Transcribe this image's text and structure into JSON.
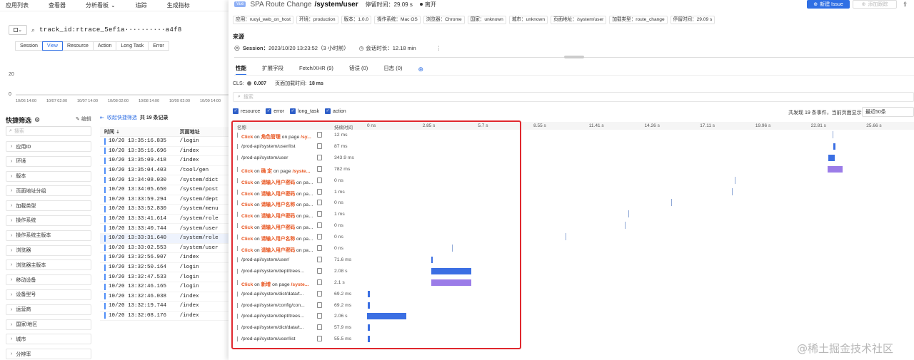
{
  "top_nav": [
    "应用列表",
    "查看器",
    "分析看板",
    "追踪",
    "生成指标"
  ],
  "top_nav_dropdown_index": 2,
  "search": {
    "scope": "",
    "query": "track_id:rtrace_5ef1a··········a4f8"
  },
  "type_bar": {
    "items": [
      "Session",
      "View",
      "Resource",
      "Action",
      "Long Task",
      "Error"
    ],
    "active": "View"
  },
  "histogram": {
    "y_ticks": [
      "20",
      "0"
    ],
    "x_ticks": [
      "10/06 14:00",
      "10/07 02:00",
      "10/07 14:00",
      "10/08 02:00",
      "10/08 14:00",
      "10/09 02:00",
      "10/09 14:00"
    ]
  },
  "quick_filter": {
    "title": "快捷筛选",
    "edit_label": "编辑",
    "search_placeholder": "搜索",
    "items": [
      "应用ID",
      "环境",
      "版本",
      "页面地址分组",
      "加载类型",
      "操作系统",
      "操作系统主版本",
      "浏览器",
      "浏览器主版本",
      "移动设备",
      "设备型号",
      "运营商",
      "国家/地区",
      "城市",
      "分辨率"
    ]
  },
  "records": {
    "collapse_label": "收起快捷筛选",
    "count_text": "共 19 条记录"
  },
  "table": {
    "headers": [
      "时间",
      "页面地址"
    ],
    "selected_index": 10,
    "rows": [
      {
        "time": "10/20 13:35:16.835",
        "page": "/login"
      },
      {
        "time": "10/20 13:35:16.696",
        "page": "/index"
      },
      {
        "time": "10/20 13:35:09.418",
        "page": "/index"
      },
      {
        "time": "10/20 13:35:04.403",
        "page": "/tool/gen"
      },
      {
        "time": "10/20 13:34:08.030",
        "page": "/system/dict"
      },
      {
        "time": "10/20 13:34:05.650",
        "page": "/system/post"
      },
      {
        "time": "10/20 13:33:59.294",
        "page": "/system/dept"
      },
      {
        "time": "10/20 13:33:52.830",
        "page": "/system/menu"
      },
      {
        "time": "10/20 13:33:41.614",
        "page": "/system/role"
      },
      {
        "time": "10/20 13:33:40.744",
        "page": "/system/user"
      },
      {
        "time": "10/20 13:33:31.640",
        "page": "/system/role"
      },
      {
        "time": "10/20 13:33:02.553",
        "page": "/system/user"
      },
      {
        "time": "10/20 13:32:56.907",
        "page": "/index"
      },
      {
        "time": "10/20 13:32:50.164",
        "page": "/login"
      },
      {
        "time": "10/20 13:32:47.533",
        "page": "/login"
      },
      {
        "time": "10/20 13:32:46.165",
        "page": "/login"
      },
      {
        "time": "10/20 13:32:46.038",
        "page": "/index"
      },
      {
        "time": "10/20 13:32:19.744",
        "page": "/index"
      },
      {
        "time": "10/20 13:32:08.176",
        "page": "/index"
      }
    ]
  },
  "drawer": {
    "framework_tag": "Vue",
    "route_label": "SPA Route Change",
    "route_path": "/system/user",
    "stay_time": "停留时间：29.09 s",
    "leave_label": "离开",
    "new_issue_label": "新建 Issue",
    "track_label": "添加跟踪",
    "tags": [
      "应用：ruoyi_web_on_host",
      "环境：production",
      "版本：1.0.0",
      "操作系统：Mac OS",
      "浏览器：Chrome",
      "国家：unknown",
      "城市：unknown",
      "页面地址：/system/user",
      "加载类型：route_change",
      "停留时间：29.09 s"
    ],
    "source_title": "来源",
    "session_label": "Session：",
    "session_time": "2023/10/20 13:23:52（3 小时前）",
    "session_duration": "会话时长：12.18 min",
    "more": "⋮",
    "tabs": [
      "性能",
      "扩展字段",
      "Fetch/XHR (9)",
      "错误 (0)",
      "日志 (0)"
    ],
    "active_tab": "性能",
    "cls_label": "CLS:",
    "cls_value": "0.007",
    "plt_label": "页面加载时间:",
    "plt_value": "18 ms",
    "search_placeholder": "搜索",
    "checkboxes": [
      "resource",
      "error",
      "long_task",
      "action"
    ],
    "events_summary": "共发现 19 条事件，当前页面显示",
    "page_size": "最近50条"
  },
  "waterfall": {
    "col_name": "名称",
    "col_duration": "持续时间",
    "time_ticks": [
      "0 ns",
      "2.85 s",
      "5.7 s",
      "8.55 s",
      "11.41 s",
      "14.26 s",
      "17.11 s",
      "19.96 s",
      "22.81 s",
      "25.66 s"
    ],
    "total_s": 28.5,
    "rows": [
      {
        "kind": "action",
        "action": "Click",
        "target": "角色管理",
        "suffix": "/sy...",
        "duration": "12 ms",
        "start": 24.28,
        "dur_s": 0.012,
        "type": "tick"
      },
      {
        "kind": "resource",
        "text": "/prod-api/system/user/list",
        "duration": "87 ms",
        "start": 24.34,
        "dur_s": 0.087,
        "type": "resource"
      },
      {
        "kind": "resource",
        "text": "/prod-api/system/user",
        "duration": "343.9 ms",
        "start": 24.05,
        "dur_s": 0.344,
        "type": "resource"
      },
      {
        "kind": "action",
        "action": "Click",
        "target": "确 定",
        "suffix": "/syste...",
        "duration": "782 ms",
        "start": 24.02,
        "dur_s": 0.782,
        "type": "action"
      },
      {
        "kind": "action",
        "action": "Click",
        "target": "请输入用户密码",
        "suffix": "p...",
        "duration": "0 ns",
        "start": 19.2,
        "dur_s": 0,
        "type": "tick"
      },
      {
        "kind": "action",
        "action": "Click",
        "target": "请输入用户密码",
        "suffix": "p...",
        "duration": "1 ms",
        "start": 19.05,
        "dur_s": 0.001,
        "type": "tick"
      },
      {
        "kind": "action",
        "action": "Click",
        "target": "请输入用户名称",
        "suffix": "p...",
        "duration": "0 ns",
        "start": 15.88,
        "dur_s": 0,
        "type": "tick"
      },
      {
        "kind": "action",
        "action": "Click",
        "target": "请输入用户密码",
        "suffix": "p...",
        "duration": "1 ms",
        "start": 13.65,
        "dur_s": 0.001,
        "type": "tick"
      },
      {
        "kind": "action",
        "action": "Click",
        "target": "请输入用户密码",
        "suffix": "p...",
        "duration": "0 ns",
        "start": 13.45,
        "dur_s": 0,
        "type": "tick"
      },
      {
        "kind": "action",
        "action": "Click",
        "target": "请输入用户名称",
        "suffix": "p...",
        "duration": "0 ns",
        "start": 10.35,
        "dur_s": 0,
        "type": "tick"
      },
      {
        "kind": "action",
        "action": "Click",
        "target": "请输入用户密码",
        "suffix": "p...",
        "duration": "0 ns",
        "start": 4.45,
        "dur_s": 0,
        "type": "tick"
      },
      {
        "kind": "resource",
        "text": "/prod-api/system/user/",
        "duration": "71.6 ms",
        "start": 3.35,
        "dur_s": 0.0716,
        "type": "resource"
      },
      {
        "kind": "resource",
        "text": "/prod-api/system/dept/trees...",
        "duration": "2.08 s",
        "start": 3.35,
        "dur_s": 2.08,
        "type": "resource"
      },
      {
        "kind": "action",
        "action": "Click",
        "target": "新增",
        "suffix": "/syste...",
        "duration": "2.1 s",
        "start": 3.35,
        "dur_s": 2.1,
        "type": "action"
      },
      {
        "kind": "resource",
        "text": "/prod-api/system/dict/data/t...",
        "duration": "69.2 ms",
        "start": 0.05,
        "dur_s": 0.0692,
        "type": "resource"
      },
      {
        "kind": "resource",
        "text": "/prod-api/system/config/con...",
        "duration": "69.2 ms",
        "start": 0.05,
        "dur_s": 0.0692,
        "type": "resource"
      },
      {
        "kind": "resource",
        "text": "/prod-api/system/dept/trees...",
        "duration": "2.06 s",
        "start": 0.0,
        "dur_s": 2.06,
        "type": "resource"
      },
      {
        "kind": "resource",
        "text": "/prod-api/system/dict/data/t...",
        "duration": "57.9 ms",
        "start": 0.05,
        "dur_s": 0.0579,
        "type": "resource"
      },
      {
        "kind": "resource",
        "text": "/prod-api/system/user/list",
        "duration": "55.5 ms",
        "start": 0.05,
        "dur_s": 0.0555,
        "type": "resource"
      }
    ]
  },
  "colors": {
    "accent": "#2f6fe4",
    "resource_bar": "#3b6fe3",
    "action_bar": "#9b7ce8",
    "highlight": "#e0282e",
    "click_text": "#e8541e"
  },
  "watermark": "@稀土掘金技术社区"
}
